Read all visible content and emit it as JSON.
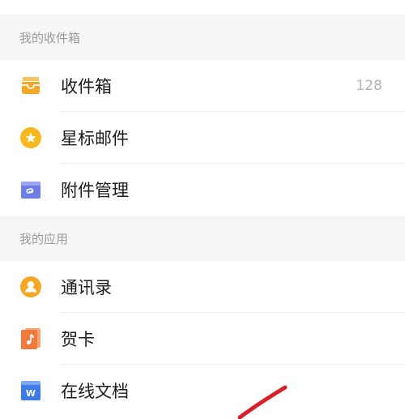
{
  "sections": [
    {
      "title": "我的收件箱",
      "items": [
        {
          "label": "收件箱",
          "count": "128",
          "icon": "inbox-tray-icon",
          "color": "#f5a623"
        },
        {
          "label": "星标邮件",
          "icon": "star-icon",
          "color": "#f8b81c"
        },
        {
          "label": "附件管理",
          "icon": "attachment-icon",
          "color": "#6d7de6"
        }
      ]
    },
    {
      "title": "我的应用",
      "items": [
        {
          "label": "通讯录",
          "icon": "contact-person-icon",
          "color": "#f5a623"
        },
        {
          "label": "贺卡",
          "icon": "greeting-card-icon",
          "color": "#f07a3c"
        },
        {
          "label": "在线文档",
          "icon": "online-doc-icon",
          "color": "#3c7be8",
          "icon_text": "W"
        }
      ]
    }
  ],
  "annotation_color": "#d8202a"
}
